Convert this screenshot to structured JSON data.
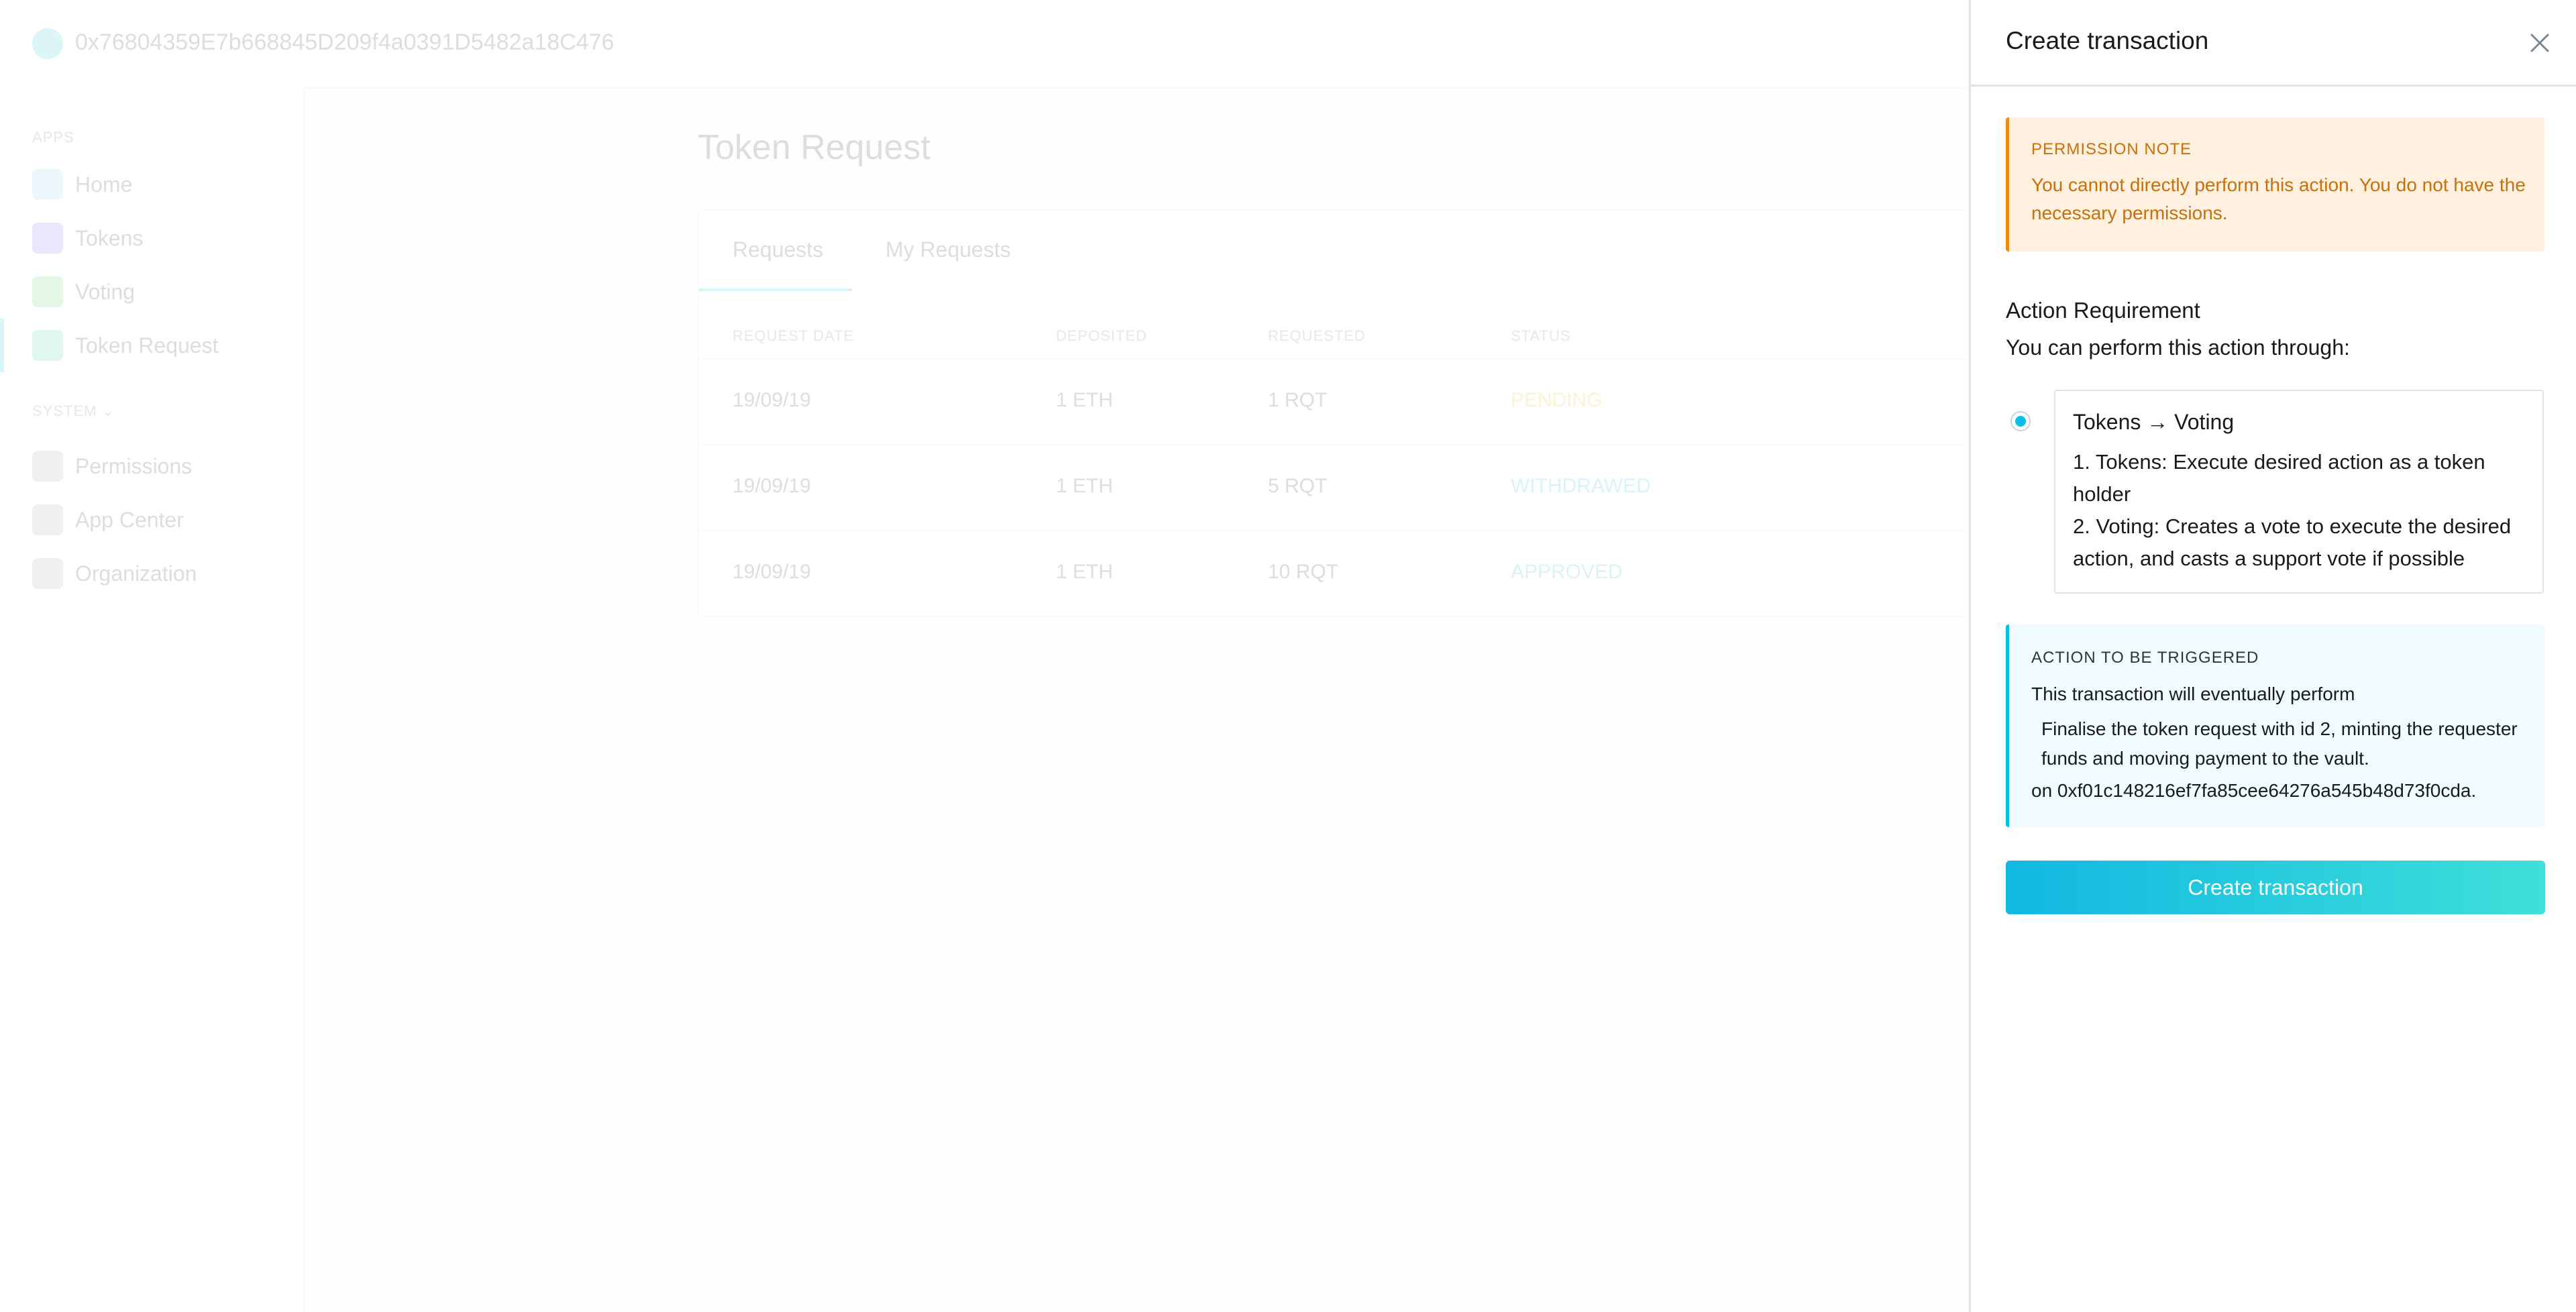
{
  "app": {
    "account_address": "0x76804359E7b668845D209f4a0391D5482a18C476",
    "sidebar": {
      "apps_heading": "APPS",
      "items": [
        "Home",
        "Tokens",
        "Voting",
        "Token Request"
      ],
      "system_heading": "SYSTEM",
      "system_items": [
        "Permissions",
        "App Center",
        "Organization"
      ]
    },
    "page_title": "Token Request",
    "tabs": [
      "Requests",
      "My Requests"
    ],
    "table": {
      "headers": [
        "REQUEST DATE",
        "DEPOSITED",
        "REQUESTED",
        "STATUS"
      ],
      "rows": [
        [
          "19/09/19",
          "1 ETH",
          "1 RQT",
          "PENDING"
        ],
        [
          "19/09/19",
          "1 ETH",
          "5 RQT",
          "WITHDRAWED"
        ],
        [
          "19/09/19",
          "1 ETH",
          "10 RQT",
          "APPROVED"
        ]
      ]
    }
  },
  "panel": {
    "title": "Create transaction",
    "close_icon": "close-icon",
    "permission_note": {
      "heading": "PERMISSION NOTE",
      "body": "You cannot directly perform this action. You do not have the necessary permissions."
    },
    "requirement": {
      "heading": "Action Requirement",
      "subtext": "You can perform this action through:",
      "option": {
        "title": "Tokens → Voting",
        "steps": [
          "1. Tokens: Execute desired action as a token holder",
          "2. Voting: Creates a vote to execute the desired action, and casts a support vote if possible"
        ]
      }
    },
    "trigger": {
      "heading": "ACTION TO BE TRIGGERED",
      "line1": "This transaction will eventually perform",
      "description": "Finalise the token request with id 2, minting the requester funds and moving payment to the vault.",
      "target": "on 0xf01c148216ef7fa85cee64276a545b48d73f0cda."
    },
    "button_label": "Create transaction"
  },
  "colors": {
    "accent": "#08bee5",
    "warning_bg": "#fff0e0",
    "warning_text": "#c8700a",
    "info_bg": "#f0fbff"
  }
}
